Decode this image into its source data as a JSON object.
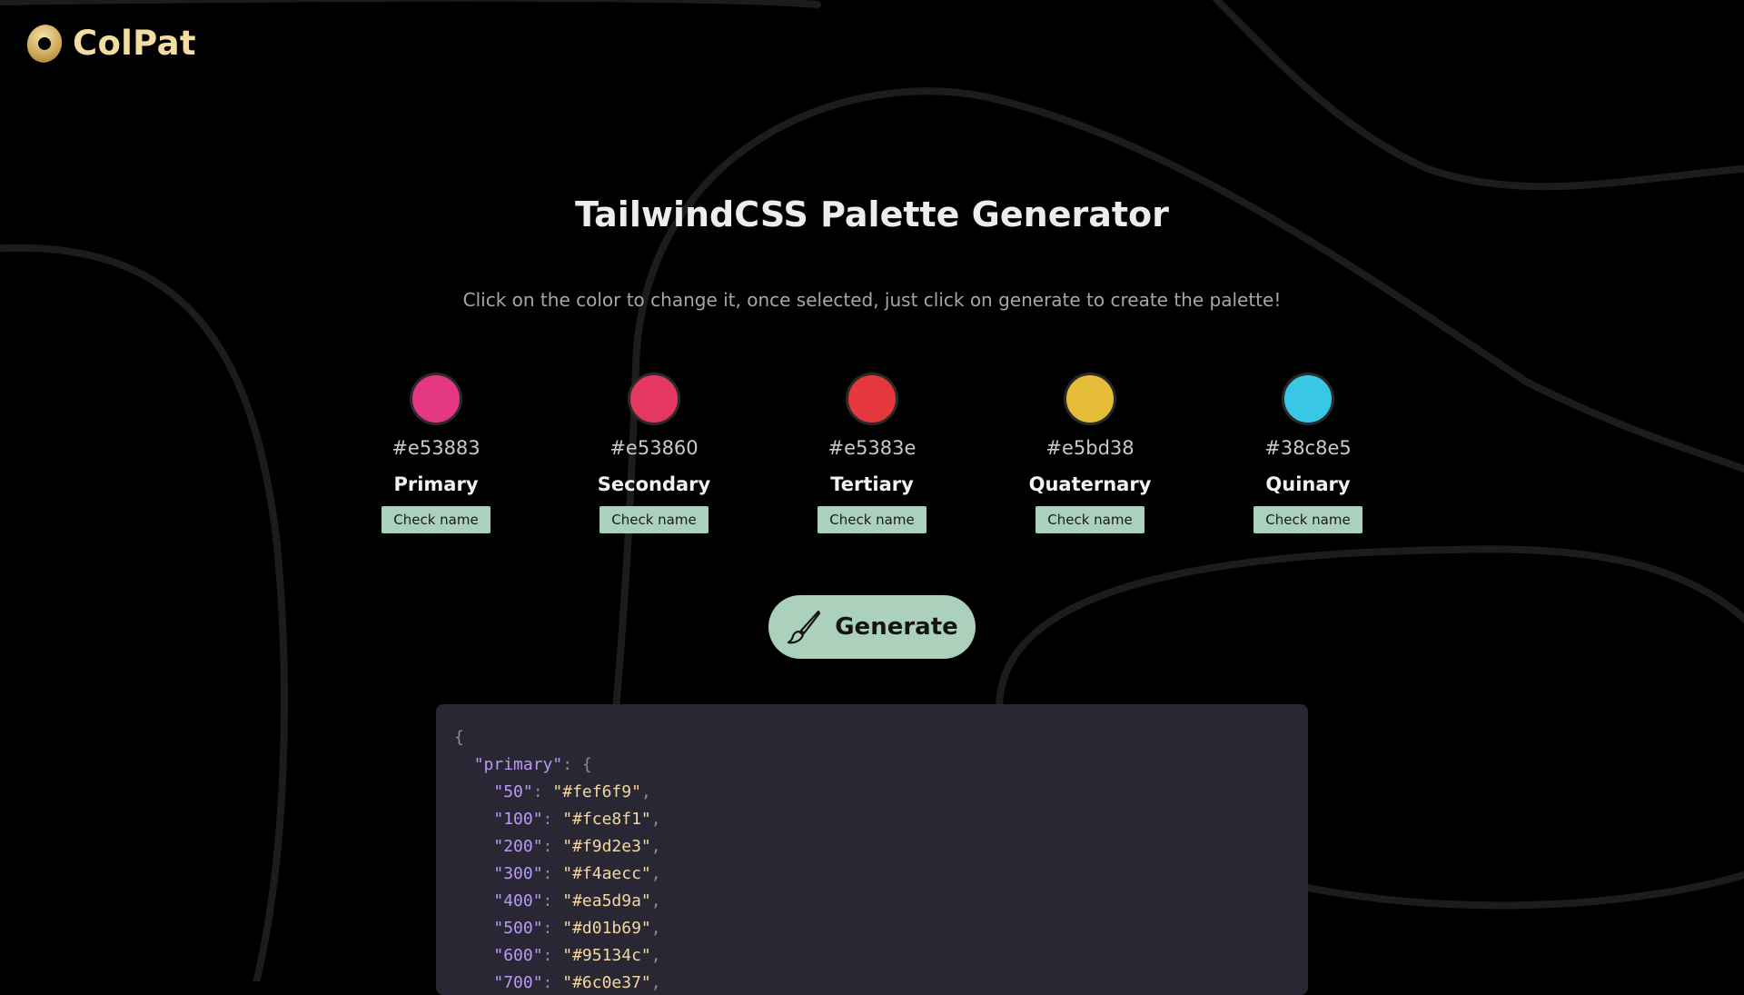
{
  "brand": {
    "name": "ColPat"
  },
  "page": {
    "title": "TailwindCSS Palette Generator",
    "subtitle": "Click on the color to change it, once selected, just click on generate to create the palette!"
  },
  "colors": [
    {
      "hex": "#e53883",
      "label": "Primary",
      "button": "Check name"
    },
    {
      "hex": "#e53860",
      "label": "Secondary",
      "button": "Check name"
    },
    {
      "hex": "#e5383e",
      "label": "Tertiary",
      "button": "Check name"
    },
    {
      "hex": "#e5bd38",
      "label": "Quaternary",
      "button": "Check name"
    },
    {
      "hex": "#38c8e5",
      "label": "Quinary",
      "button": "Check name"
    }
  ],
  "generate": {
    "label": "Generate",
    "icon": "paintbrush-icon"
  },
  "output": {
    "open": "{",
    "group_key": "\"primary\"",
    "group_open": ": {",
    "entries": [
      {
        "key": "\"50\"",
        "value": "\"#fef6f9\""
      },
      {
        "key": "\"100\"",
        "value": "\"#fce8f1\""
      },
      {
        "key": "\"200\"",
        "value": "\"#f9d2e3\""
      },
      {
        "key": "\"300\"",
        "value": "\"#f4aecc\""
      },
      {
        "key": "\"400\"",
        "value": "\"#ea5d9a\""
      },
      {
        "key": "\"500\"",
        "value": "\"#d01b69\""
      },
      {
        "key": "\"600\"",
        "value": "\"#95134c\""
      },
      {
        "key": "\"700\"",
        "value": "\"#6c0e37\""
      }
    ]
  },
  "theme": {
    "background": "#000000",
    "accent": "#abd1bc",
    "brand_gold": "#f4dda0",
    "code_bg": "#292734"
  }
}
